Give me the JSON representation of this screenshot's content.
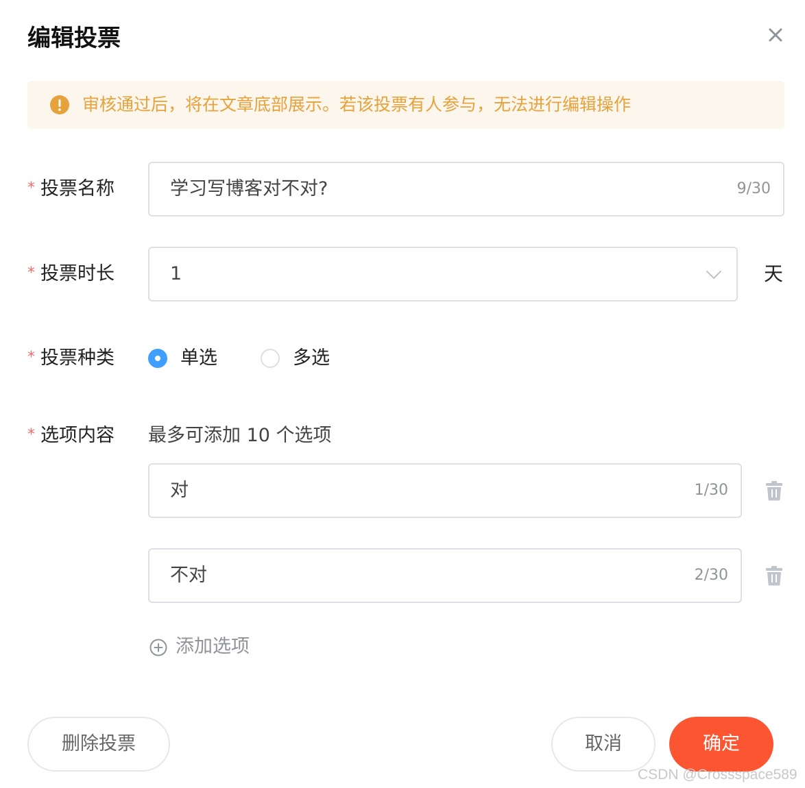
{
  "dialog": {
    "title": "编辑投票"
  },
  "notice": {
    "text": "审核通过后，将在文章底部展示。若该投票有人参与，无法进行编辑操作",
    "color": "#e6a23c",
    "icon": "exclamation-circle-icon"
  },
  "form": {
    "required_mark": "*",
    "name": {
      "label": "投票名称",
      "value": "学习写博客对不对?",
      "counter": "9/30"
    },
    "duration": {
      "label": "投票时长",
      "value": "1",
      "unit": "天",
      "icon": "chevron-down-icon"
    },
    "type": {
      "label": "投票种类",
      "options": [
        {
          "label": "单选",
          "checked": true
        },
        {
          "label": "多选",
          "checked": false
        }
      ]
    },
    "options": {
      "label": "选项内容",
      "hint": "最多可添加 10 个选项",
      "items": [
        {
          "value": "对",
          "counter": "1/30"
        },
        {
          "value": "不对",
          "counter": "2/30"
        }
      ],
      "add_label": "添加选项"
    }
  },
  "footer": {
    "delete_label": "删除投票",
    "cancel_label": "取消",
    "confirm_label": "确定",
    "confirm_color": "#fc5531"
  },
  "watermark": "CSDN @Crossspace589"
}
